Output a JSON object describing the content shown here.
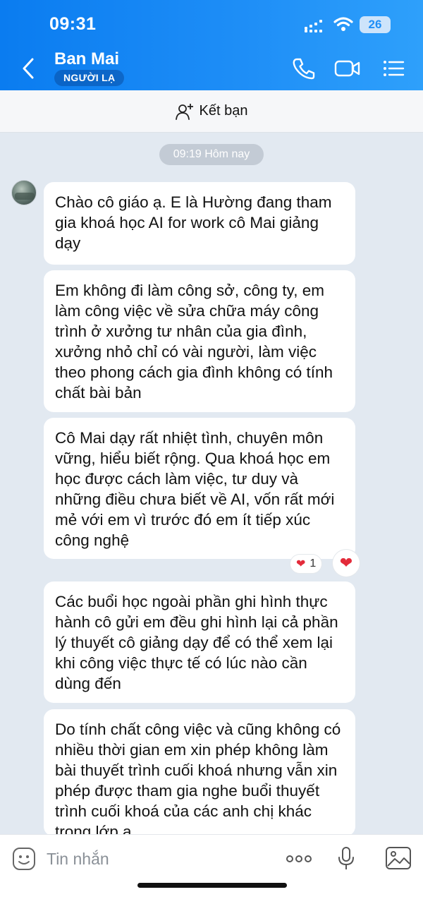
{
  "status_bar": {
    "time": "09:31",
    "battery": "26"
  },
  "header": {
    "name": "Ban Mai",
    "badge": "NGƯỜI LẠ"
  },
  "friend_bar": {
    "label": "Kết bạn"
  },
  "time_chip": "09:19 Hôm nay",
  "messages": [
    {
      "text": "Chào cô giáo ạ. E là Hường đang tham gia khoá học AI for work cô Mai giảng dạy"
    },
    {
      "text": "Em không đi làm công sở, công ty, em làm công việc về sửa chữa máy công trình ở xưởng tư nhân của gia đình, xưởng nhỏ chỉ có vài người, làm việc theo phong cách gia đình không có tính chất bài bản"
    },
    {
      "text": "Cô Mai dạy rất nhiệt tình, chuyên môn vững, hiểu biết rộng. Qua khoá học em học được cách làm việc, tư duy và những điều chưa biết về AI, vốn rất mới mẻ với em vì trước đó em ít tiếp xúc công nghệ"
    },
    {
      "text": "Các buổi học ngoài phần ghi hình thực hành cô gửi em đều ghi hình lại cả phần lý thuyết cô giảng dạy để có thể xem lại khi công việc thực tế có lúc nào cần dùng đến"
    },
    {
      "text": "Do tính chất công việc và cũng không có nhiều thời gian em xin phép không làm bài thuyết trình cuối khoá nhưng vẫn xin phép được tham gia nghe buổi thuyết trình cuối khoá của các anh chị khác trong lớp ạ"
    }
  ],
  "reaction": {
    "icon": "heart-icon",
    "count": "1",
    "color": "#e32b3a"
  },
  "input": {
    "placeholder": "Tin nhắn"
  },
  "colors": {
    "header": "#1f8ff7",
    "chat_bg": "#e2e9f1",
    "bubble": "#ffffff"
  }
}
